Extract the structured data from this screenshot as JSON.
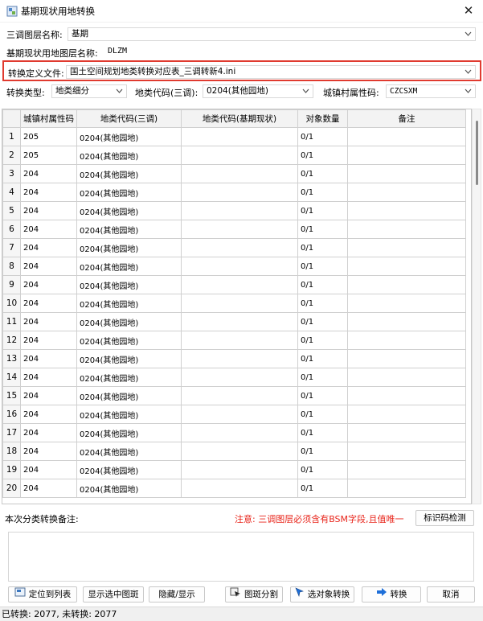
{
  "window": {
    "title": "基期现状用地转换",
    "close_glyph": "✕"
  },
  "form": {
    "layer_label": "三调图层名称:",
    "layer_value": "基期",
    "base_layer_label": "基期现状用地图层名称:",
    "base_layer_value": "DLZM",
    "def_file_label": "转换定义文件:",
    "def_file_value": "国土空间规划地类转换对应表_三调转新4.ini",
    "convert_type_label": "转换类型:",
    "convert_type_value": "地类细分",
    "land_code_label": "地类代码(三调):",
    "land_code_value": "0204(其他园地)",
    "town_code_label": "城镇村属性码:",
    "town_code_value": "CZCSXM"
  },
  "grid": {
    "columns": [
      "城镇村属性码",
      "地类代码(三调)",
      "地类代码(基期现状)",
      "对象数量",
      "备注"
    ],
    "rows": [
      {
        "n": "1",
        "c": "205",
        "d": "0204(其他园地)",
        "b": "",
        "q": "0/1",
        "r": ""
      },
      {
        "n": "2",
        "c": "205",
        "d": "0204(其他园地)",
        "b": "",
        "q": "0/1",
        "r": ""
      },
      {
        "n": "3",
        "c": "204",
        "d": "0204(其他园地)",
        "b": "",
        "q": "0/1",
        "r": ""
      },
      {
        "n": "4",
        "c": "204",
        "d": "0204(其他园地)",
        "b": "",
        "q": "0/1",
        "r": ""
      },
      {
        "n": "5",
        "c": "204",
        "d": "0204(其他园地)",
        "b": "",
        "q": "0/1",
        "r": ""
      },
      {
        "n": "6",
        "c": "204",
        "d": "0204(其他园地)",
        "b": "",
        "q": "0/1",
        "r": ""
      },
      {
        "n": "7",
        "c": "204",
        "d": "0204(其他园地)",
        "b": "",
        "q": "0/1",
        "r": ""
      },
      {
        "n": "8",
        "c": "204",
        "d": "0204(其他园地)",
        "b": "",
        "q": "0/1",
        "r": ""
      },
      {
        "n": "9",
        "c": "204",
        "d": "0204(其他园地)",
        "b": "",
        "q": "0/1",
        "r": ""
      },
      {
        "n": "10",
        "c": "204",
        "d": "0204(其他园地)",
        "b": "",
        "q": "0/1",
        "r": ""
      },
      {
        "n": "11",
        "c": "204",
        "d": "0204(其他园地)",
        "b": "",
        "q": "0/1",
        "r": ""
      },
      {
        "n": "12",
        "c": "204",
        "d": "0204(其他园地)",
        "b": "",
        "q": "0/1",
        "r": ""
      },
      {
        "n": "13",
        "c": "204",
        "d": "0204(其他园地)",
        "b": "",
        "q": "0/1",
        "r": ""
      },
      {
        "n": "14",
        "c": "204",
        "d": "0204(其他园地)",
        "b": "",
        "q": "0/1",
        "r": ""
      },
      {
        "n": "15",
        "c": "204",
        "d": "0204(其他园地)",
        "b": "",
        "q": "0/1",
        "r": ""
      },
      {
        "n": "16",
        "c": "204",
        "d": "0204(其他园地)",
        "b": "",
        "q": "0/1",
        "r": ""
      },
      {
        "n": "17",
        "c": "204",
        "d": "0204(其他园地)",
        "b": "",
        "q": "0/1",
        "r": ""
      },
      {
        "n": "18",
        "c": "204",
        "d": "0204(其他园地)",
        "b": "",
        "q": "0/1",
        "r": ""
      },
      {
        "n": "19",
        "c": "204",
        "d": "0204(其他园地)",
        "b": "",
        "q": "0/1",
        "r": ""
      },
      {
        "n": "20",
        "c": "204",
        "d": "0204(其他园地)",
        "b": "",
        "q": "0/1",
        "r": ""
      }
    ]
  },
  "remark": {
    "label": "本次分类转换备注:",
    "warning": "注意: 三调图层必须含有BSM字段,且值唯一",
    "check_button": "标识码检测"
  },
  "buttons": {
    "locate": "定位到列表",
    "show_selected": "显示选中图斑",
    "hide_show": "隐藏/显示",
    "split": "图斑分割",
    "convert_selected": "选对象转换",
    "convert": "转换",
    "cancel": "取消"
  },
  "status": "已转换: 2077, 未转换: 2077",
  "colors": {
    "highlight": "#e03a2f",
    "warning": "#e8251b",
    "accent_arrow": "#1e6fd9"
  }
}
